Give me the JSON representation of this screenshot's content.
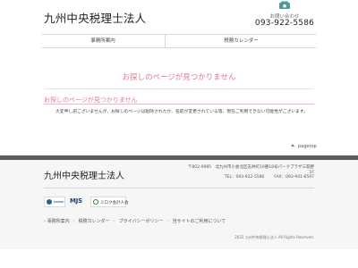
{
  "header": {
    "site_title": "九州中央税理士法人",
    "contact_label": "お問い合わせ",
    "phone": "093-922-5586"
  },
  "nav": {
    "items": [
      {
        "label": "事務所案内"
      },
      {
        "label": "税務カレンダー"
      }
    ]
  },
  "main": {
    "title": "お探しのページが見つかりません",
    "subtitle": "お探しのページが見つかりません",
    "message": "大変申し訳ございませんが、お探しのページは削除されたか、名前が変更されている等、現在ご利用できない可能性がございます。"
  },
  "pagetop_label": "pagetop",
  "footer": {
    "title": "九州中央税理士法人",
    "address": "〒802-0985　北九州市小倉北区志井町10番18号パークプラザ三萩野1F",
    "tel": "TEL：093-922-5586",
    "fax": "FAX：093-941-6597",
    "logos": [
      {
        "text": "MJS"
      },
      {
        "text": "ミロク会計人会"
      }
    ],
    "links": [
      {
        "label": "事務所案内"
      },
      {
        "label": "税務カレンダー"
      },
      {
        "label": "プライバシーポリシー"
      },
      {
        "label": "当サイトのご利用について"
      }
    ],
    "copyright": "2022 九州中央税理士法人 All Rights Reserved."
  },
  "colors": {
    "accent_pink": "#e07a8d",
    "footer_dark": "#5c5c5c",
    "phone_icon": "#4a9a9a"
  }
}
